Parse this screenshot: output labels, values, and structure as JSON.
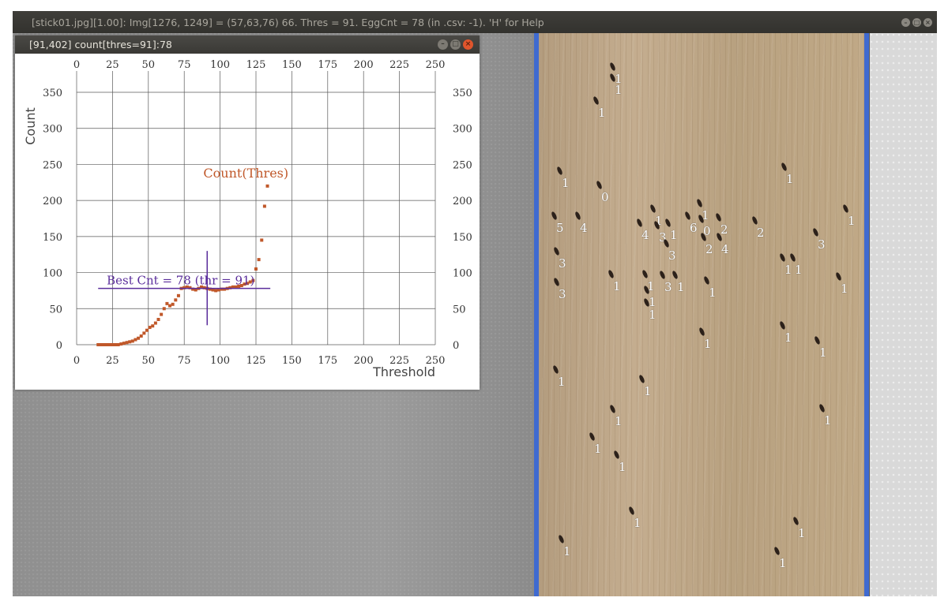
{
  "main_window": {
    "title": "[stick01.jpg][1.00]: Img[1276, 1249] = (57,63,76) 66.  Thres = 91.  EggCnt = 78 (in .csv: -1).  'H' for Help",
    "buttons": [
      "–",
      "□",
      "×"
    ]
  },
  "plot_window": {
    "title": "[91,402] count[thres=91]:78",
    "buttons": [
      "–",
      "□",
      "×"
    ]
  },
  "chart_data": {
    "type": "scatter",
    "title": "",
    "xlabel": "Threshold",
    "ylabel": "Count",
    "xlim": [
      0,
      250
    ],
    "ylim": [
      0,
      350
    ],
    "x_ticks": [
      0,
      25,
      50,
      75,
      100,
      125,
      150,
      175,
      200,
      225,
      250
    ],
    "y_ticks": [
      0,
      50,
      100,
      150,
      200,
      250,
      300,
      350
    ],
    "grid": true,
    "legend": "Count(Thres)",
    "annotation": "Best Cnt = 78 (thr = 91)",
    "crosshair": {
      "x": 91,
      "y": 78
    },
    "point_color": "#c0582a",
    "annotation_color": "#5a2d9b",
    "points": [
      [
        15,
        0
      ],
      [
        17,
        0
      ],
      [
        19,
        0
      ],
      [
        21,
        0
      ],
      [
        23,
        0
      ],
      [
        25,
        0
      ],
      [
        27,
        0
      ],
      [
        29,
        0
      ],
      [
        31,
        1
      ],
      [
        33,
        2
      ],
      [
        35,
        3
      ],
      [
        37,
        4
      ],
      [
        39,
        5
      ],
      [
        41,
        7
      ],
      [
        43,
        9
      ],
      [
        45,
        12
      ],
      [
        47,
        16
      ],
      [
        49,
        20
      ],
      [
        51,
        24
      ],
      [
        53,
        26
      ],
      [
        55,
        30
      ],
      [
        57,
        35
      ],
      [
        59,
        42
      ],
      [
        61,
        50
      ],
      [
        63,
        57
      ],
      [
        65,
        54
      ],
      [
        67,
        56
      ],
      [
        69,
        62
      ],
      [
        71,
        68
      ],
      [
        73,
        78
      ],
      [
        75,
        79
      ],
      [
        77,
        80
      ],
      [
        79,
        79
      ],
      [
        81,
        77
      ],
      [
        83,
        76
      ],
      [
        85,
        78
      ],
      [
        87,
        80
      ],
      [
        89,
        79
      ],
      [
        91,
        78
      ],
      [
        93,
        77
      ],
      [
        95,
        76
      ],
      [
        97,
        75
      ],
      [
        99,
        76
      ],
      [
        101,
        77
      ],
      [
        103,
        77
      ],
      [
        105,
        78
      ],
      [
        107,
        79
      ],
      [
        109,
        80
      ],
      [
        111,
        80
      ],
      [
        113,
        81
      ],
      [
        115,
        82
      ],
      [
        117,
        84
      ],
      [
        119,
        85
      ],
      [
        121,
        87
      ],
      [
        123,
        89
      ],
      [
        125,
        105
      ],
      [
        127,
        118
      ],
      [
        129,
        145
      ],
      [
        131,
        192
      ],
      [
        133,
        220
      ]
    ]
  },
  "eggs": [
    {
      "x": 778,
      "y": 93,
      "label": "1"
    },
    {
      "x": 778,
      "y": 107,
      "label": "1"
    },
    {
      "x": 757,
      "y": 136,
      "label": "1"
    },
    {
      "x": 711,
      "y": 225,
      "label": "1"
    },
    {
      "x": 761,
      "y": 243,
      "label": "0"
    },
    {
      "x": 995,
      "y": 220,
      "label": "1"
    },
    {
      "x": 704,
      "y": 282,
      "label": "5"
    },
    {
      "x": 734,
      "y": 282,
      "label": "4"
    },
    {
      "x": 829,
      "y": 273,
      "label": "1"
    },
    {
      "x": 812,
      "y": 291,
      "label": "4"
    },
    {
      "x": 834,
      "y": 294,
      "label": "3"
    },
    {
      "x": 848,
      "y": 291,
      "label": "1"
    },
    {
      "x": 873,
      "y": 282,
      "label": "6"
    },
    {
      "x": 888,
      "y": 266,
      "label": "1"
    },
    {
      "x": 890,
      "y": 286,
      "label": "0"
    },
    {
      "x": 912,
      "y": 284,
      "label": "2"
    },
    {
      "x": 958,
      "y": 288,
      "label": "2"
    },
    {
      "x": 1073,
      "y": 273,
      "label": "1"
    },
    {
      "x": 1035,
      "y": 303,
      "label": "3"
    },
    {
      "x": 893,
      "y": 309,
      "label": "2"
    },
    {
      "x": 913,
      "y": 309,
      "label": "4"
    },
    {
      "x": 846,
      "y": 317,
      "label": "3"
    },
    {
      "x": 707,
      "y": 327,
      "label": "3"
    },
    {
      "x": 993,
      "y": 335,
      "label": "1"
    },
    {
      "x": 1006,
      "y": 335,
      "label": "1"
    },
    {
      "x": 776,
      "y": 356,
      "label": "1"
    },
    {
      "x": 819,
      "y": 356,
      "label": "1"
    },
    {
      "x": 841,
      "y": 357,
      "label": "3"
    },
    {
      "x": 857,
      "y": 357,
      "label": "1"
    },
    {
      "x": 897,
      "y": 364,
      "label": "1"
    },
    {
      "x": 1064,
      "y": 359,
      "label": "1"
    },
    {
      "x": 707,
      "y": 366,
      "label": "3"
    },
    {
      "x": 821,
      "y": 376,
      "label": "1"
    },
    {
      "x": 821,
      "y": 392,
      "label": "1"
    },
    {
      "x": 891,
      "y": 429,
      "label": "1"
    },
    {
      "x": 993,
      "y": 421,
      "label": "1"
    },
    {
      "x": 1037,
      "y": 440,
      "label": "1"
    },
    {
      "x": 706,
      "y": 477,
      "label": "1"
    },
    {
      "x": 815,
      "y": 489,
      "label": "1"
    },
    {
      "x": 1043,
      "y": 526,
      "label": "1"
    },
    {
      "x": 778,
      "y": 527,
      "label": "1"
    },
    {
      "x": 752,
      "y": 562,
      "label": "1"
    },
    {
      "x": 783,
      "y": 585,
      "label": "1"
    },
    {
      "x": 802,
      "y": 656,
      "label": "1"
    },
    {
      "x": 1010,
      "y": 669,
      "label": "1"
    },
    {
      "x": 713,
      "y": 692,
      "label": "1"
    },
    {
      "x": 986,
      "y": 707,
      "label": "1"
    }
  ]
}
